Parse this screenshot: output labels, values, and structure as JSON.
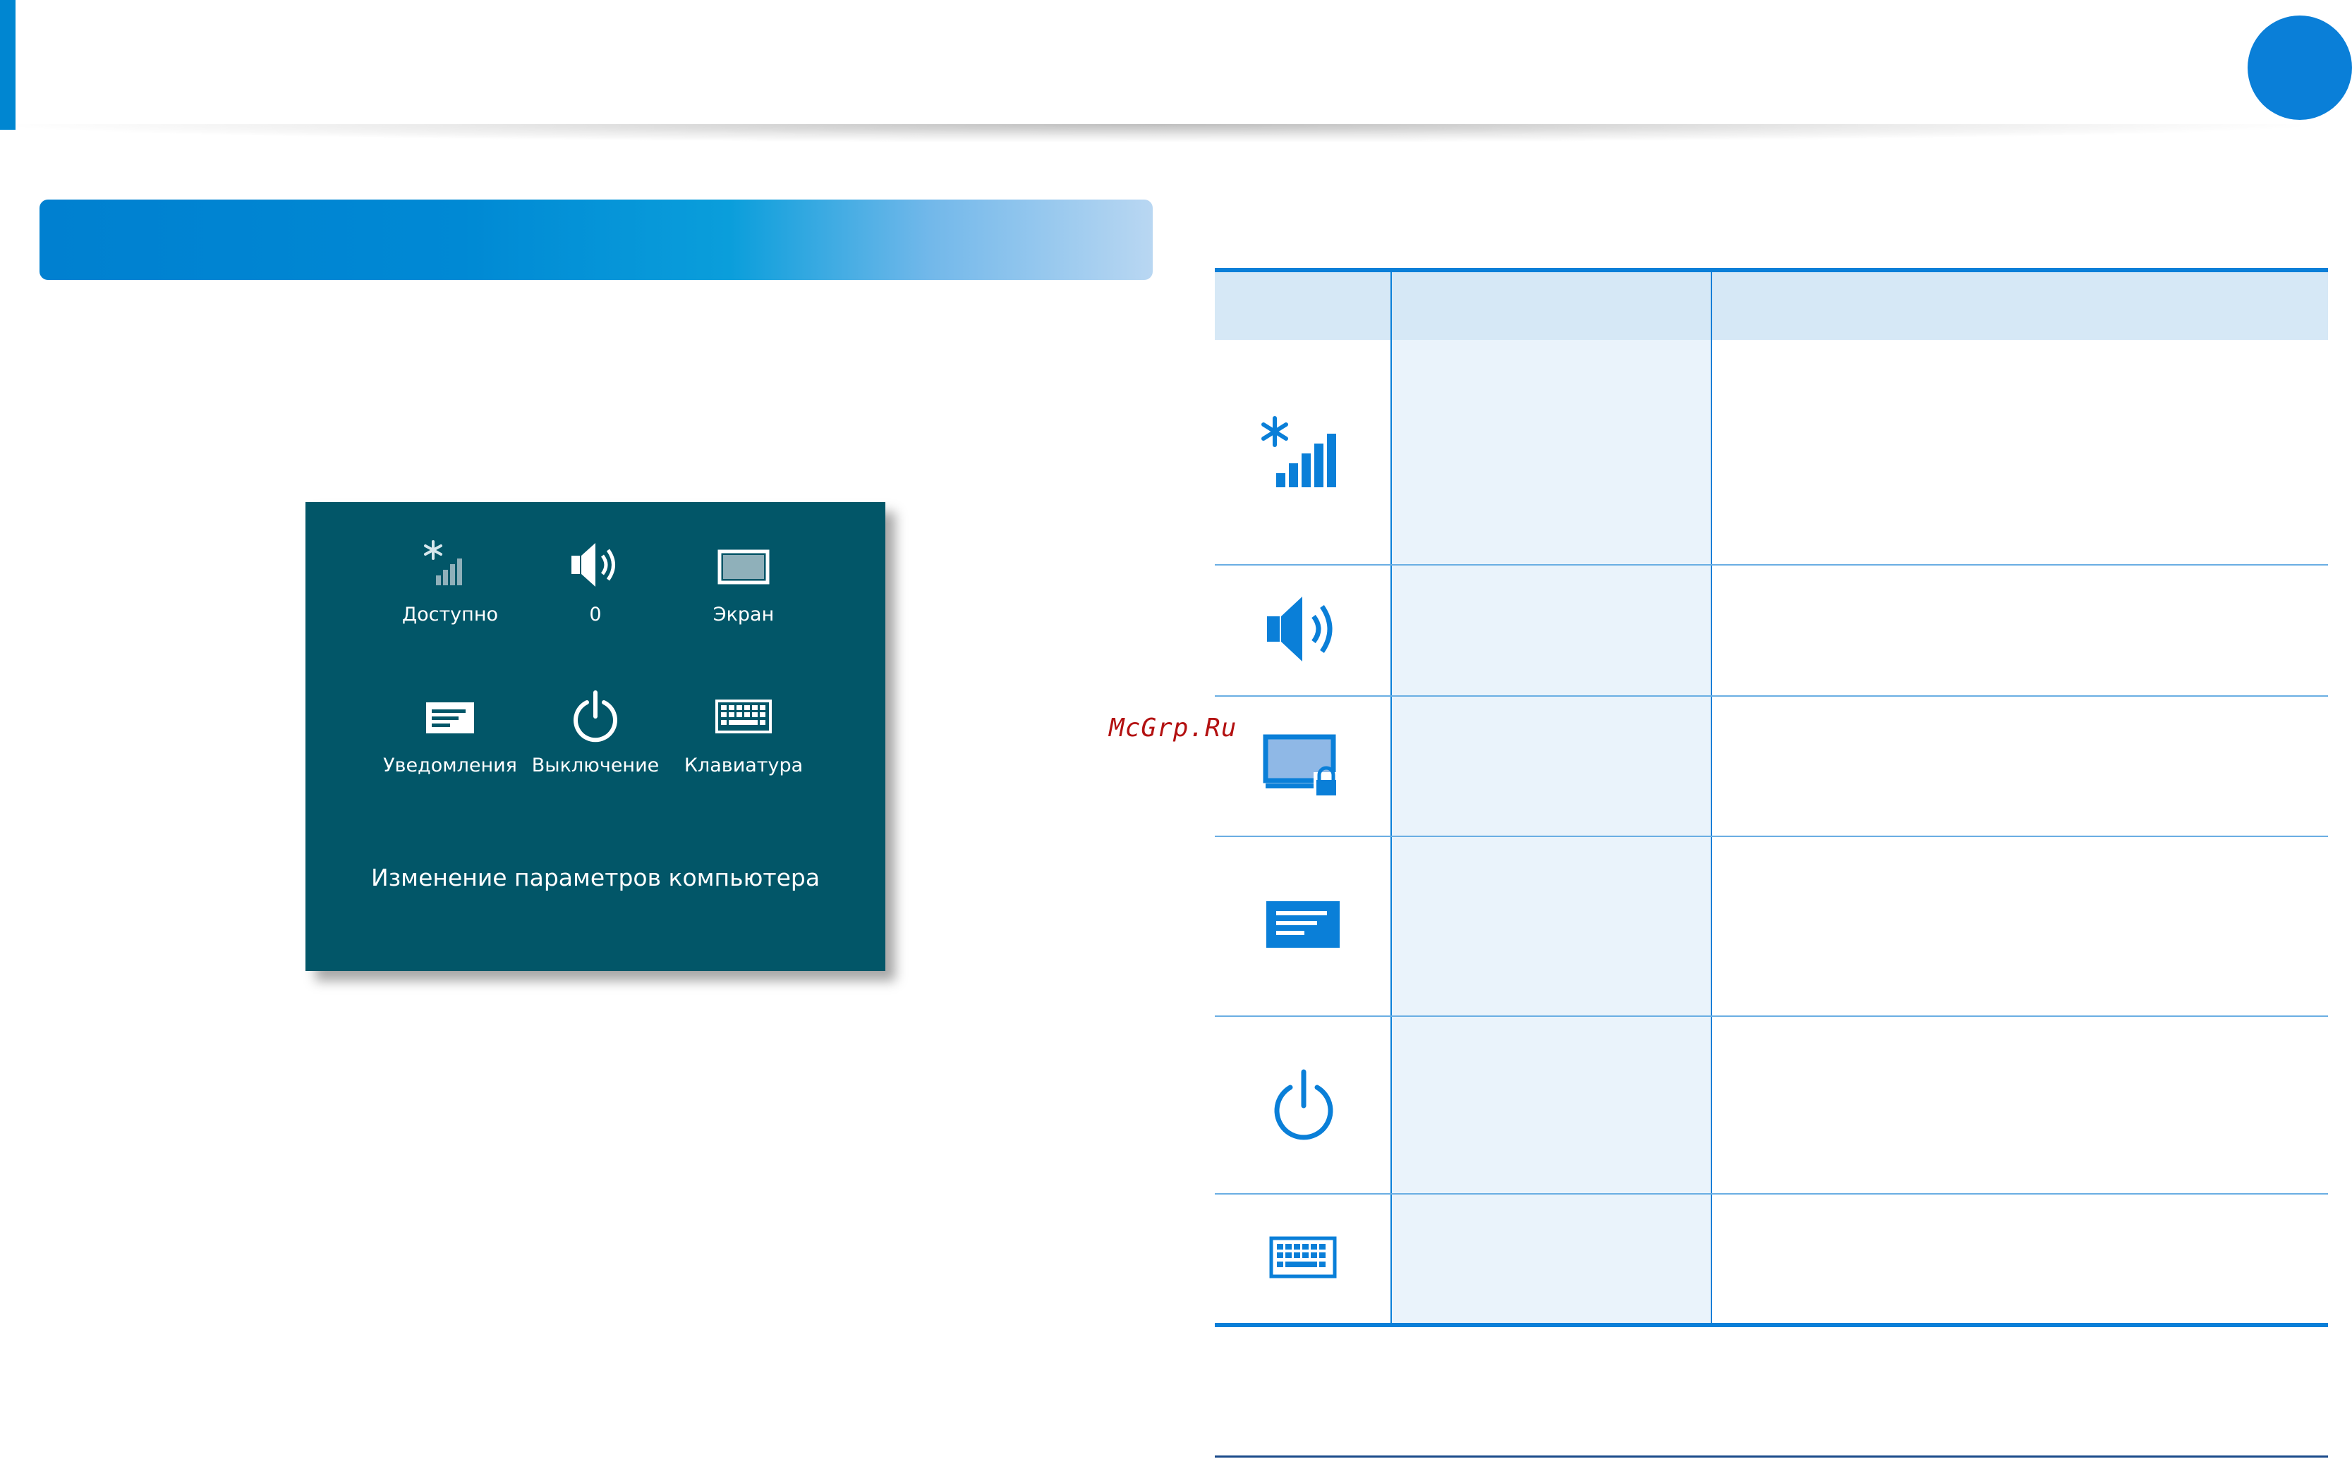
{
  "colors": {
    "accent": "#0a7fd8",
    "charm_panel": "#025668",
    "table_header": "#d6e8f6"
  },
  "charm_panel": {
    "tiles": [
      {
        "icon": "network-icon",
        "label": "Доступно"
      },
      {
        "icon": "volume-icon",
        "label": "0"
      },
      {
        "icon": "screen-icon",
        "label": "Экран"
      },
      {
        "icon": "notifications-icon",
        "label": "Уведомления"
      },
      {
        "icon": "power-icon",
        "label": "Выключение"
      },
      {
        "icon": "keyboard-icon",
        "label": "Клавиатура"
      }
    ],
    "settings_link": "Изменение параметров компьютера"
  },
  "table": {
    "rows": [
      {
        "icon": "network-icon"
      },
      {
        "icon": "volume-icon"
      },
      {
        "icon": "screen-lock-icon"
      },
      {
        "icon": "notifications-icon"
      },
      {
        "icon": "power-icon"
      },
      {
        "icon": "keyboard-icon"
      }
    ]
  },
  "watermark": "McGrp.Ru"
}
